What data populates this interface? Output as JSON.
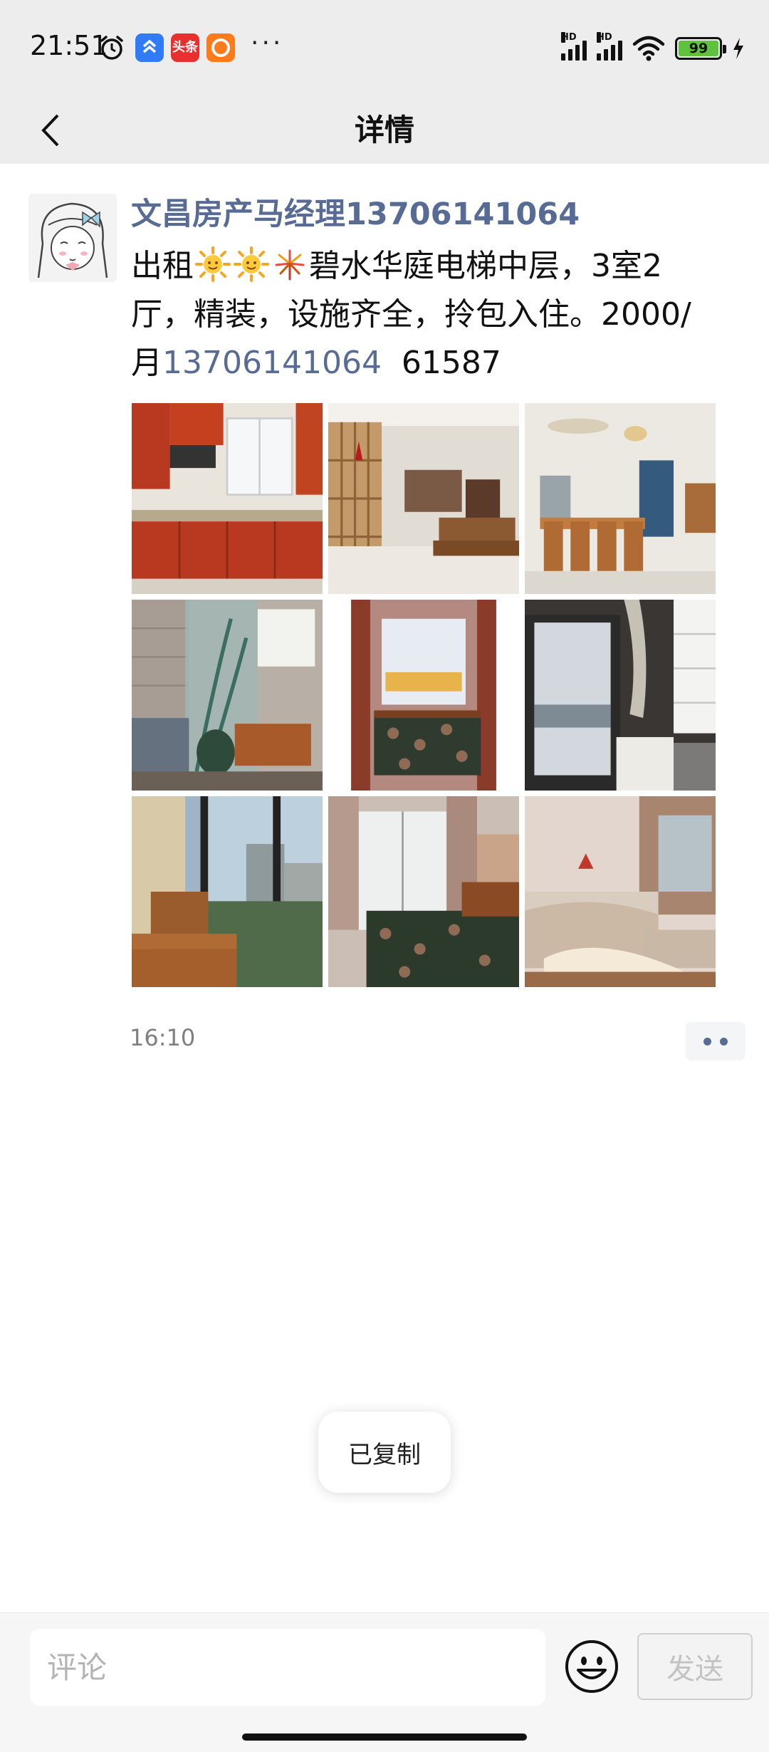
{
  "status_bar": {
    "time": "21:51",
    "app_badge_text": "头条",
    "more": "···",
    "network_1": "HD",
    "network_2": "HD",
    "battery_level": "99"
  },
  "header": {
    "title": "详情",
    "back_icon": "chevron-left-icon"
  },
  "post": {
    "author": "文昌房产马经理13706141064",
    "text_prefix": "出租",
    "emojis": [
      "sun-face-icon",
      "sun-face-icon",
      "firework-icon"
    ],
    "text_main": "碧水华庭电梯中层，3室2厅，精装，设施齐全，拎包入住。2000/月",
    "phone": "13706141064",
    "text_suffix": "  61587",
    "time": "16:10",
    "photos": [
      {
        "scene": "kitchen"
      },
      {
        "scene": "living-room-partition"
      },
      {
        "scene": "dining-room-door"
      },
      {
        "scene": "bathroom"
      },
      {
        "scene": "bedroom-window"
      },
      {
        "scene": "balcony-laundry"
      },
      {
        "scene": "study-desk"
      },
      {
        "scene": "bedroom-balcony-door"
      },
      {
        "scene": "bedroom-sunlit"
      }
    ]
  },
  "toast": {
    "text": "已复制"
  },
  "comment_bar": {
    "placeholder": "评论",
    "send_label": "发送"
  },
  "colors": {
    "link": "#576b95",
    "header_bg": "#ededed",
    "battery": "#5ec23f"
  }
}
